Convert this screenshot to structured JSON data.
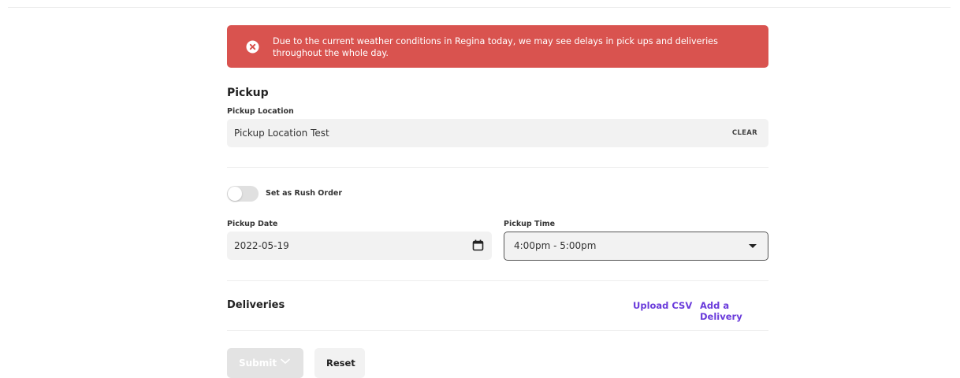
{
  "alert": {
    "message": "Due to the current weather conditions in Regina today, we may see delays in pick ups and deliveries throughout the whole day.",
    "icon": "close-circle-icon",
    "color": "#d9534f"
  },
  "pickup": {
    "title": "Pickup",
    "location_label": "Pickup Location",
    "location_value": "Pickup Location Test",
    "clear_label": "CLEAR"
  },
  "rush_order": {
    "label": "Set as Rush Order",
    "enabled": false
  },
  "pickup_date": {
    "label": "Pickup Date",
    "value": "2022-05-19",
    "icon": "calendar-icon"
  },
  "pickup_time": {
    "label": "Pickup Time",
    "value": "4:00pm - 5:00pm",
    "icon": "caret-down-icon"
  },
  "deliveries": {
    "title": "Deliveries",
    "upload_csv_label": "Upload CSV",
    "add_delivery_label": "Add a Delivery",
    "link_color": "#6a3bdb"
  },
  "actions": {
    "submit_label": "Submit",
    "reset_label": "Reset"
  }
}
